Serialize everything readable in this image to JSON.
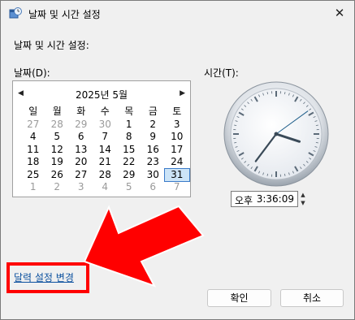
{
  "window": {
    "title": "날짜 및 시간 설정",
    "close_glyph": "✕"
  },
  "heading": "날짜 및 시간 설정:",
  "date_label": "날짜(D):",
  "time_label": "시간(T):",
  "calendar": {
    "month_title": "2025년 5월",
    "prev_glyph": "◀",
    "next_glyph": "▶",
    "weekdays": [
      "일",
      "월",
      "화",
      "수",
      "목",
      "금",
      "토"
    ],
    "weeks": [
      [
        "27",
        "28",
        "29",
        "30",
        "1",
        "2",
        "3"
      ],
      [
        "4",
        "5",
        "6",
        "7",
        "8",
        "9",
        "10"
      ],
      [
        "11",
        "12",
        "13",
        "14",
        "15",
        "16",
        "17"
      ],
      [
        "18",
        "19",
        "20",
        "21",
        "22",
        "23",
        "24"
      ],
      [
        "25",
        "26",
        "27",
        "28",
        "29",
        "30",
        "31"
      ],
      [
        "1",
        "2",
        "3",
        "4",
        "5",
        "6",
        "7"
      ]
    ],
    "selected_day": "31"
  },
  "time": {
    "ampm": "오후",
    "value": "3:36:09",
    "up_glyph": "▲",
    "down_glyph": "▼"
  },
  "link_text": "달력 설정 변경",
  "buttons": {
    "ok": "확인",
    "cancel": "취소"
  },
  "colors": {
    "annotation_red": "#ff0000",
    "link_blue": "#0a4f9e"
  }
}
